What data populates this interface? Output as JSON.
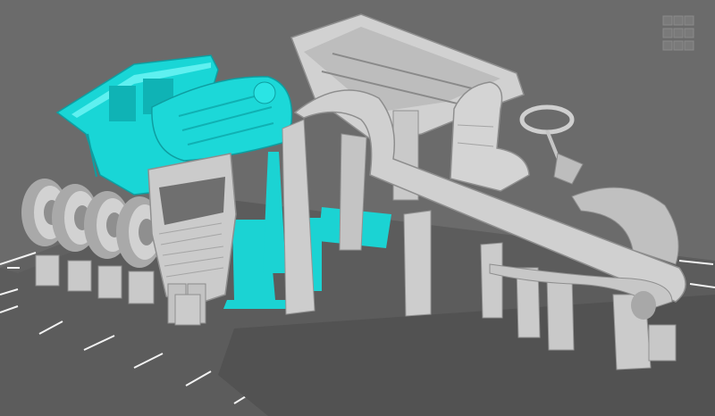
{
  "app": {
    "viewport_title": ""
  },
  "colors": {
    "background": "#6b6b6b",
    "build_plate": "#5b5b5b",
    "grid_lines": "#ffffff",
    "selected_model": "#19d6d6",
    "selected_model_shadow": "#0fa5a8",
    "unselected_model": "#c7c7c7",
    "unselected_model_shadow": "#9a9a9a",
    "supports": "#cfcfcf"
  },
  "scene": {
    "objects": [
      {
        "name": "cab",
        "state": "selected"
      },
      {
        "name": "radiator-hood",
        "state": "selected"
      },
      {
        "name": "truck-bed",
        "state": "unselected"
      },
      {
        "name": "chassis-fenders",
        "state": "unselected"
      },
      {
        "name": "seat",
        "state": "unselected"
      },
      {
        "name": "steering-wheel",
        "state": "unselected"
      },
      {
        "name": "spare-tires",
        "state": "unselected",
        "count": 4
      },
      {
        "name": "door",
        "state": "unselected"
      }
    ]
  },
  "view_cube": {
    "icon": "view-cube-icon"
  }
}
